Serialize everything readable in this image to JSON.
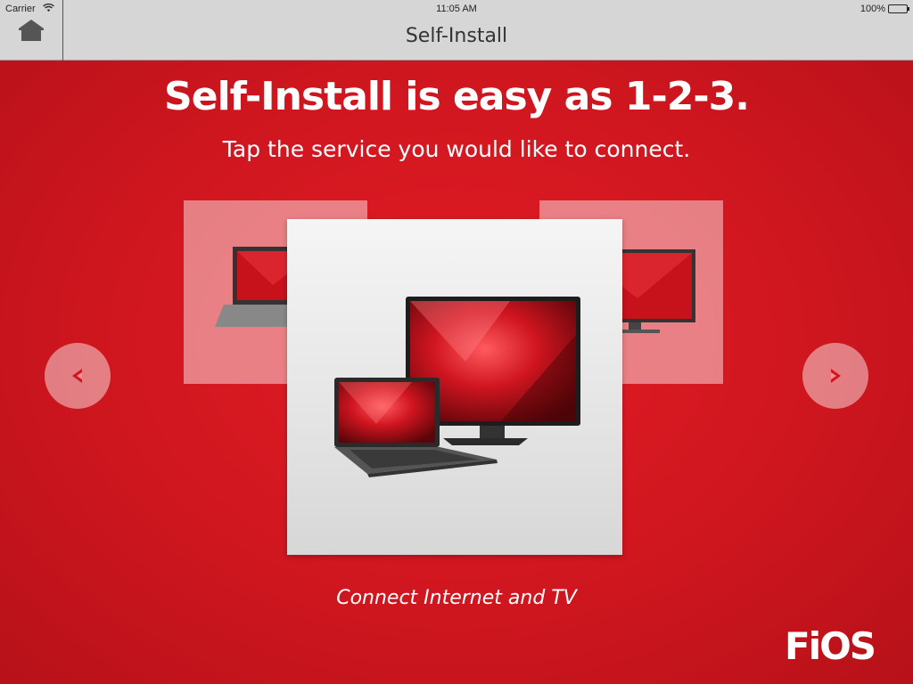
{
  "status_bar": {
    "carrier": "Carrier",
    "time": "11:05 AM",
    "battery": "100%"
  },
  "nav": {
    "title": "Self-Install",
    "home_icon": "home-icon"
  },
  "main": {
    "headline": "Self-Install is easy as 1-2-3.",
    "subheadline": "Tap the service you would like to connect.",
    "carousel": {
      "selected_caption": "Connect Internet and TV",
      "prev_icon": "chevron-left-icon",
      "next_icon": "chevron-right-icon"
    }
  },
  "brand": {
    "logo_text": "FiOS"
  },
  "colors": {
    "brand_red": "#cf161f",
    "nav_grey": "#d6d6d6",
    "arrow_red": "#d4141e"
  }
}
